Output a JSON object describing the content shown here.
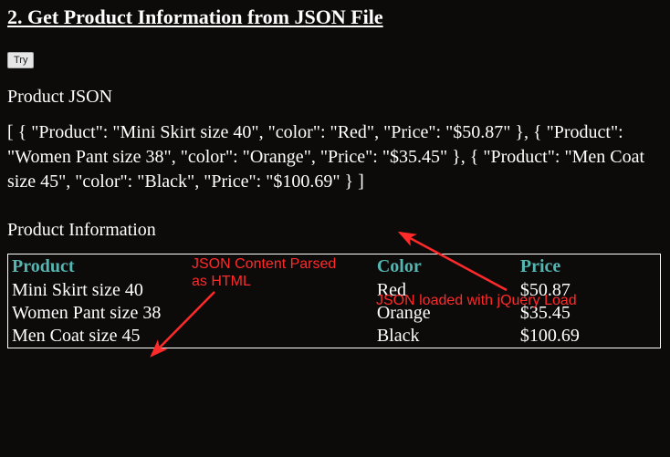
{
  "heading": "2. Get Product Information from JSON File",
  "try_button_label": "Try",
  "json_label": "Product JSON",
  "json_raw": "[ { \"Product\": \"Mini Skirt size 40\", \"color\": \"Red\", \"Price\": \"$50.87\" }, { \"Product\": \"Women Pant size 38\", \"color\": \"Orange\", \"Price\": \"$35.45\" }, { \"Product\": \"Men Coat size 45\", \"color\": \"Black\", \"Price\": \"$100.69\" } ]",
  "info_label": "Product Information",
  "annotations": {
    "parsed": "JSON Content Parsed as HTML",
    "loaded": "JSON loaded with jQuery Load"
  },
  "table": {
    "headers": {
      "product": "Product",
      "color": "Color",
      "price": "Price"
    },
    "rows": [
      {
        "product": "Mini Skirt size 40",
        "color": "Red",
        "price": "$50.87"
      },
      {
        "product": "Women Pant size 38",
        "color": "Orange",
        "price": "$35.45"
      },
      {
        "product": "Men Coat size 45",
        "color": "Black",
        "price": "$100.69"
      }
    ]
  }
}
